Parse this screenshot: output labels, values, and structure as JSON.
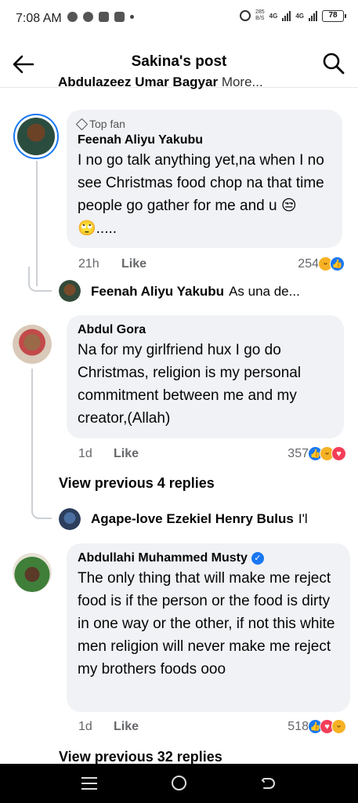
{
  "status": {
    "time": "7:08 AM",
    "net_speed_top": "285",
    "net_speed_bottom": "B/S",
    "sig1": "4G",
    "sig2": "4G",
    "battery": "78"
  },
  "header": {
    "title": "Sakina's post"
  },
  "cutoff_row": {
    "name": "Abdulazeez Umar Bagyar",
    "msg": "More..."
  },
  "comments": [
    {
      "badge": "Top fan",
      "author": "Feenah Aliyu Yakubu",
      "text": "I no go talk anything yet,na when I no see Christmas food chop na that time people go gather for me and u 😒🙄.....",
      "time": "21h",
      "like_label": "Like",
      "reaction_count": "254"
    },
    {
      "author": "Abdul Gora",
      "text": "Na for my girlfriend hux I go do Christmas, religion is my personal commitment between me and my creator,(Allah)",
      "time": "1d",
      "like_label": "Like",
      "reaction_count": "357"
    },
    {
      "author": "Abdullahi Muhammed Musty",
      "text": "The only thing that will make me reject food is if the person or the food is dirty in one way or the other, if not this white men religion will never make me reject my brothers foods ooo",
      "time": "1d",
      "like_label": "Like",
      "reaction_count": "518"
    }
  ],
  "replies": [
    {
      "name": "Feenah Aliyu Yakubu",
      "msg": "As una de..."
    },
    {
      "name": "Agape-love Ezekiel Henry Bulus",
      "msg": "I'l"
    }
  ],
  "view_previous": [
    "View previous 4 replies",
    "View previous 32 replies"
  ],
  "colors": {
    "accent": "#1877f2",
    "bubble": "#f0f2f5",
    "love": "#f33e58",
    "haha": "#f7b125"
  }
}
